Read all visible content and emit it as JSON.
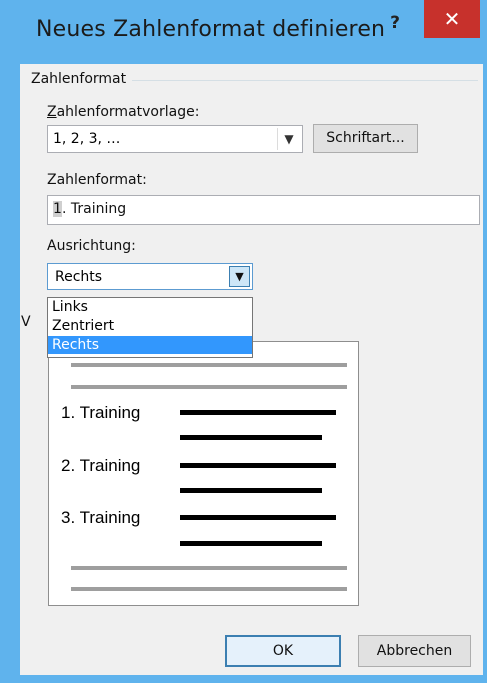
{
  "dialog": {
    "title": "Neues Zahlenformat definieren",
    "help_label": "?",
    "close_label": "✕"
  },
  "section": {
    "heading": "Zahlenformat"
  },
  "template": {
    "label": "Zahlenformatvorlage:",
    "value": "1, 2, 3, …",
    "font_button": "Schriftart..."
  },
  "format": {
    "label": "Zahlenformat:",
    "value_highlight": "1",
    "value_rest": ". Training"
  },
  "alignment": {
    "label": "Ausrichtung:",
    "value": "Rechts",
    "options": [
      {
        "label": "Links",
        "selected": false
      },
      {
        "label": "Zentriert",
        "selected": false
      },
      {
        "label": "Rechts",
        "selected": true
      }
    ]
  },
  "preview": {
    "label_partial": "V",
    "items": [
      "1. Training",
      "2. Training",
      "3. Training"
    ]
  },
  "buttons": {
    "ok": "OK",
    "cancel": "Abbrechen"
  },
  "colors": {
    "title_bar": "#5fb3ed",
    "close": "#c7312c",
    "selection": "#3297fd"
  }
}
